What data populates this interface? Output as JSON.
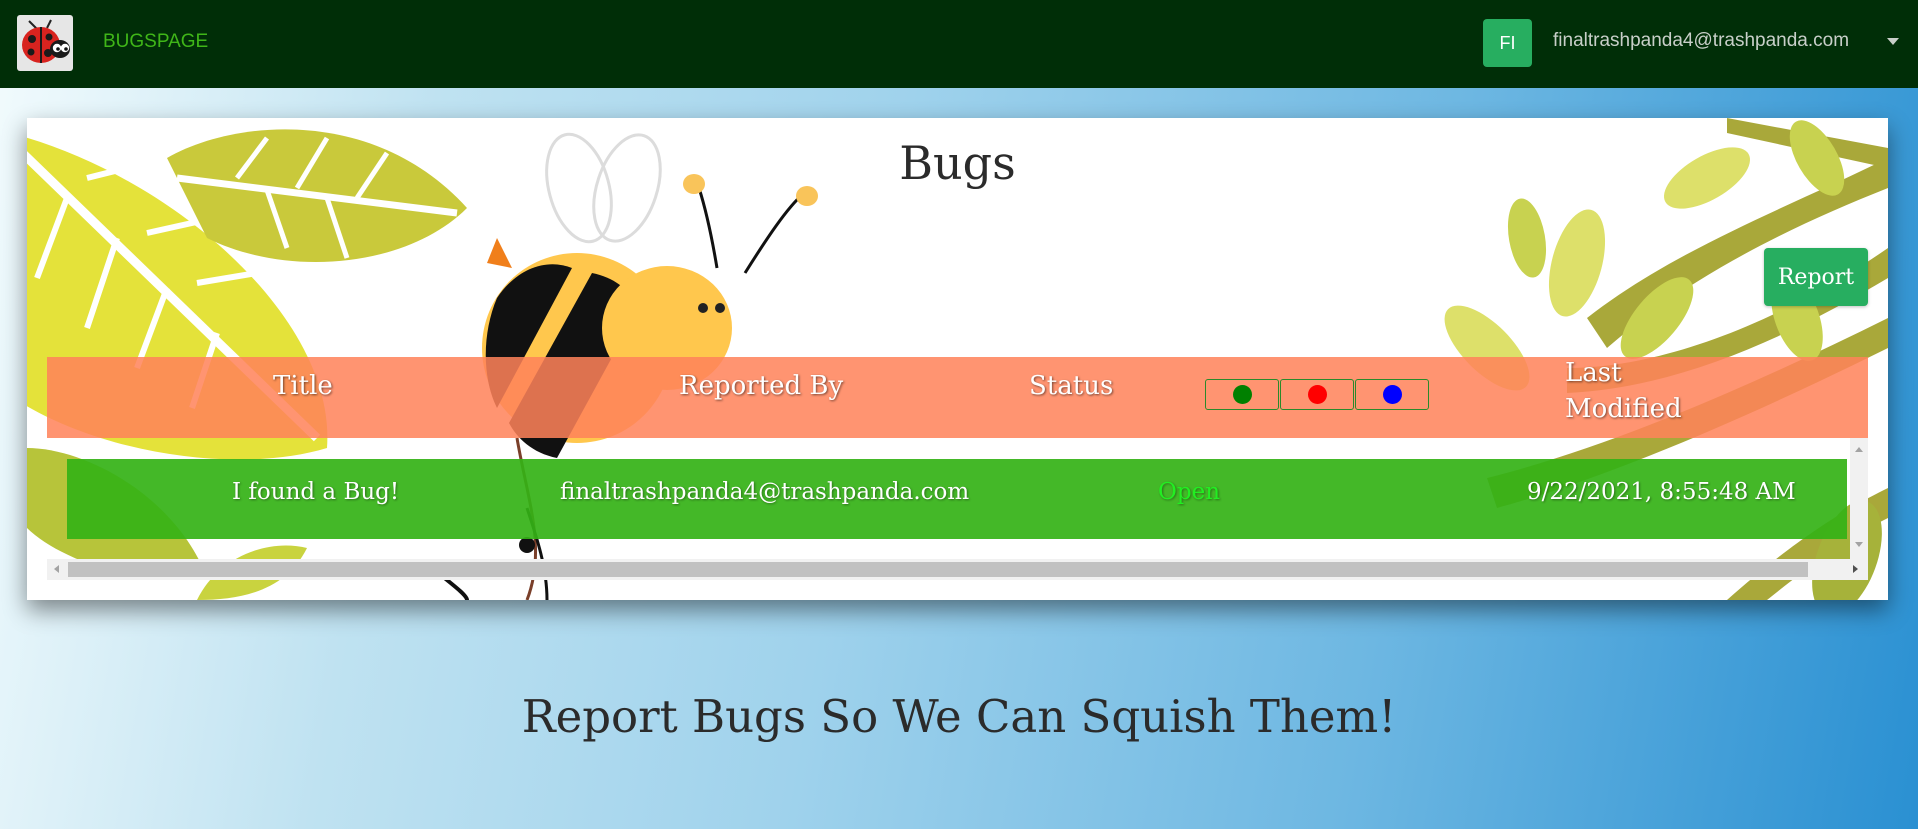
{
  "navbar": {
    "brand": "BUGSPAGE",
    "avatar_initials": "FI",
    "user_email": "finaltrashpanda4@trashpanda.com",
    "logo_icon": "ladybug-icon"
  },
  "card": {
    "title": "Bugs",
    "report_label": "Report",
    "columns": {
      "title": "Title",
      "reported_by": "Reported By",
      "status": "Status",
      "last_modified": "Last Modified"
    },
    "status_filters": [
      {
        "name": "green-filter",
        "color": "#008000"
      },
      {
        "name": "red-filter",
        "color": "#ff0000"
      },
      {
        "name": "blue-filter",
        "color": "#0000ff"
      }
    ],
    "rows": [
      {
        "title": "I found a Bug!",
        "reported_by": "finaltrashpanda4@trashpanda.com",
        "status": "Open",
        "last_modified": "9/22/2021, 8:55:48 AM"
      }
    ]
  },
  "tagline": "Report Bugs So We Can Squish Them!",
  "colors": {
    "navbar_bg": "#002e07",
    "brand_text": "#3fb618",
    "accent_button": "#27ae60",
    "table_head": "#ff825a",
    "row_bg": "#34b216",
    "status_open": "#22ee22"
  }
}
